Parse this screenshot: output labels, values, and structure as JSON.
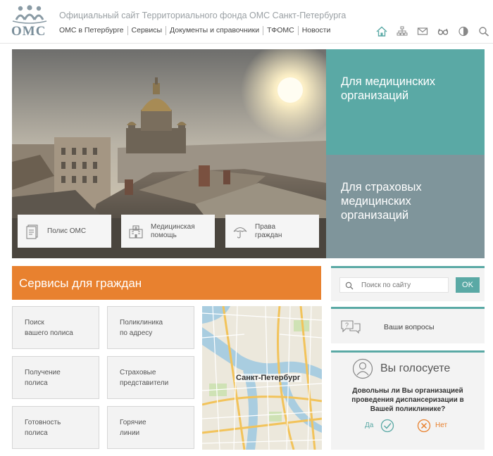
{
  "header": {
    "logo_text": "ОМС",
    "site_title": "Официальный сайт Территориального фонда ОМС Санкт-Петербурга",
    "nav": [
      {
        "label": "ОМС в Петербурге"
      },
      {
        "label": "Сервисы"
      },
      {
        "label": "Документы и справочники"
      },
      {
        "label": "ТФОМС"
      },
      {
        "label": "Новости"
      }
    ],
    "icons": [
      "home-icon",
      "sitemap-icon",
      "mail-icon",
      "glasses-icon",
      "contrast-icon",
      "search-icon"
    ]
  },
  "hero": {
    "tiles": [
      {
        "label": "Полис ОМС",
        "icon": "document-icon"
      },
      {
        "label": "Медицинская\nпомощь",
        "icon": "hospital-icon"
      },
      {
        "label": "Права\nграждан",
        "icon": "umbrella-icon"
      }
    ]
  },
  "panels": {
    "medical": "Для медицинских\nорганизаций",
    "insurance": "Для страховых\nмедицинских\nорганизаций"
  },
  "services": {
    "title": "Сервисы для граждан",
    "items": [
      {
        "label": "Поиск\nвашего полиса"
      },
      {
        "label": "Поликлиника\nпо адресу"
      },
      {
        "label": "Получение\nполиса"
      },
      {
        "label": "Страховые\nпредставители"
      },
      {
        "label": "Готовность\nполиса"
      },
      {
        "label": "Горячие\nлинии"
      }
    ],
    "map_label": "Санкт-Петербург"
  },
  "search": {
    "placeholder": "Поиск по сайту",
    "button": "OK"
  },
  "questions": {
    "label": "Ваши вопросы"
  },
  "vote": {
    "title": "Вы голосуете",
    "question": "Довольны ли Вы организацией\nпроведения диспансеризации в\nВашей поликлинике?",
    "yes": "Да",
    "no": "Нет"
  },
  "colors": {
    "accent_teal": "#5aa9a5",
    "accent_orange": "#e8812f",
    "panel_gray": "#7f959b"
  }
}
